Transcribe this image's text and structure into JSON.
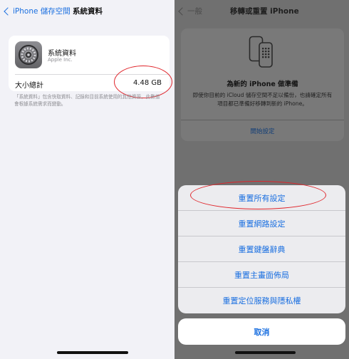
{
  "left": {
    "nav": {
      "back_label": "iPhone 儲存空間",
      "title": "系統資料"
    },
    "app": {
      "name": "系統資料",
      "developer": "Apple Inc.",
      "icon": "gear-icon"
    },
    "size": {
      "label": "大小總計",
      "value": "4.48 GB"
    },
    "note": "「系統資料」包含快取資料、記錄和目前系統使用的其他資源，此數值會根據系統需求而變動。"
  },
  "right": {
    "nav": {
      "back_label": "一般",
      "title": "移轉或重置 iPhone"
    },
    "prepare": {
      "title": "為新的 iPhone 做準備",
      "description": "即使你目前的 iCloud 儲存空間不足以備份，也請確定所有項目都已準備好移轉到新的 iPhone。",
      "link": "開始設定",
      "icon": "phone-transfer-icon"
    },
    "sheet": {
      "items": [
        "重置所有設定",
        "重置網路設定",
        "重置鍵盤辭典",
        "重置主畫面佈局",
        "重置定位服務與隱私權"
      ],
      "cancel": "取消"
    }
  },
  "colors": {
    "accent": "#1a6fe0",
    "highlight_ring": "#e0242a"
  }
}
